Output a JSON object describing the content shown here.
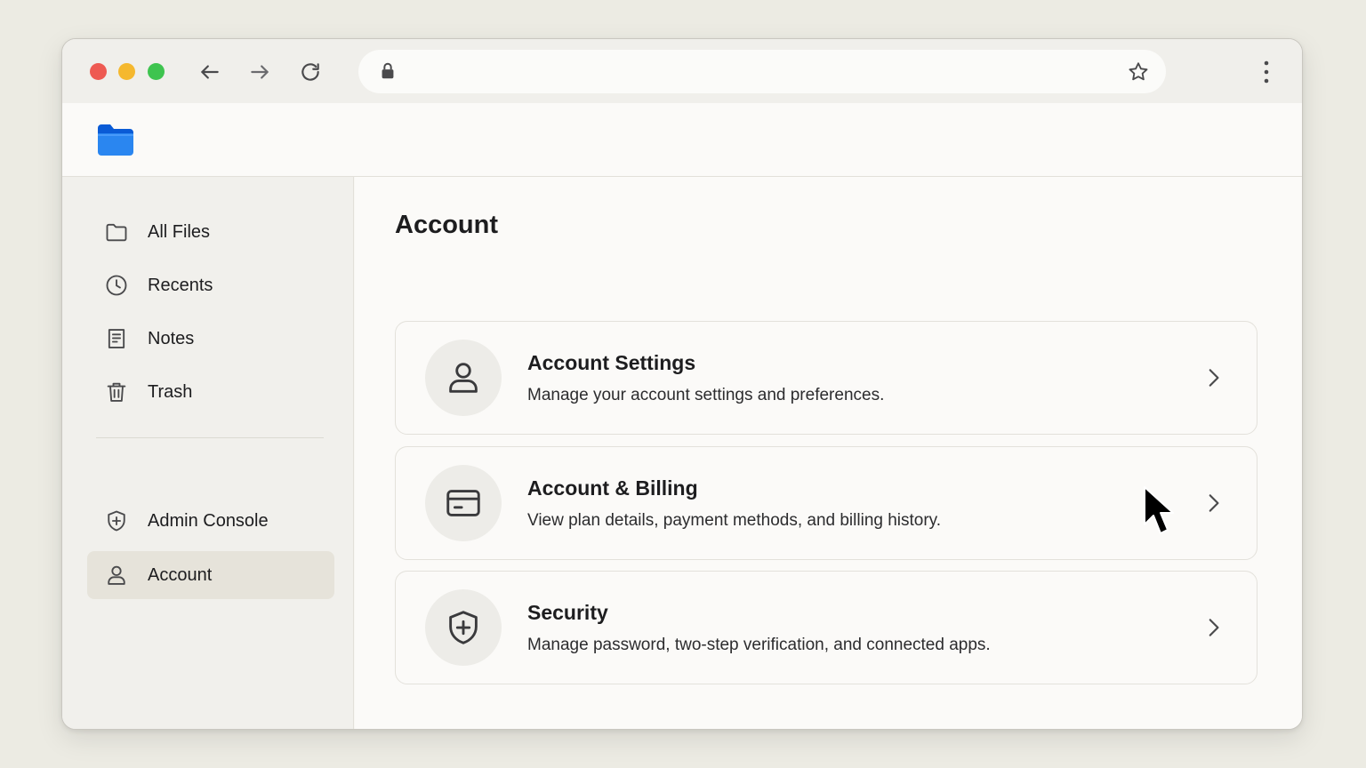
{
  "browser": {
    "traffic_lights": {
      "close": "#ee5a52",
      "minimize": "#f5b82e",
      "maximize": "#3ec44f"
    },
    "address_text": ""
  },
  "app": {
    "accent": "#1a73e8"
  },
  "sidebar": {
    "items": [
      {
        "label": "All Files",
        "icon": "folder-icon"
      },
      {
        "label": "Recents",
        "icon": "clock-icon"
      },
      {
        "label": "Notes",
        "icon": "notes-icon"
      },
      {
        "label": "Trash",
        "icon": "trash-icon"
      }
    ],
    "admin_items": [
      {
        "label": "Admin Console",
        "icon": "shield-plus-icon"
      },
      {
        "label": "Account",
        "icon": "user-icon",
        "active": true
      }
    ]
  },
  "main": {
    "title": "Account",
    "cards": [
      {
        "title": "Account Settings",
        "description": "Manage your account settings and preferences.",
        "icon": "user-icon"
      },
      {
        "title": "Account & Billing",
        "description": "View plan details, payment methods, and billing history.",
        "icon": "credit-card-icon"
      },
      {
        "title": "Security",
        "description": "Manage password, two-step verification, and connected apps.",
        "icon": "shield-plus-icon"
      }
    ]
  }
}
